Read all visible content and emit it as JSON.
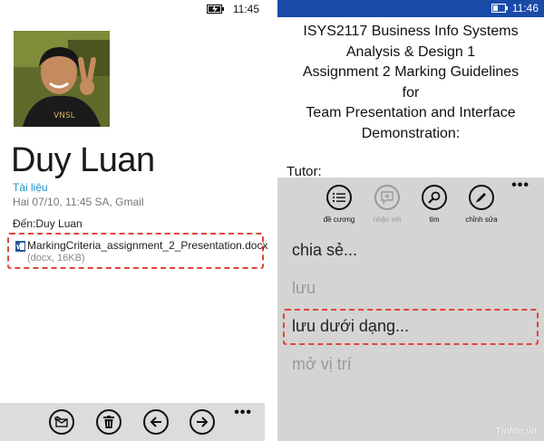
{
  "left": {
    "status": {
      "time": "11:45",
      "battery_icon": "battery-charging-icon"
    },
    "contact": {
      "name": "Duy Luan"
    },
    "email": {
      "folder": "Tài liệu",
      "meta": "Hai 07/10, 11:45 SA, Gmail",
      "to_label": "Đến:",
      "to_name": "Duy Luan",
      "attachment": {
        "filename": "MarkingCriteria_assignment_2_Presentation.docx",
        "info": "(docx, 16KB)",
        "icon": "word-doc-icon"
      }
    },
    "appbar": {
      "more": "•••"
    }
  },
  "right": {
    "status": {
      "time": "11:46",
      "battery_icon": "battery-icon",
      "color": "#1a4aa8"
    },
    "document": {
      "title_lines": [
        "ISYS2117 Business Info Systems",
        "Analysis & Design 1",
        "Assignment 2 Marking Guidelines",
        "for",
        "Team Presentation and Interface",
        "Demonstration:"
      ],
      "tutor": "Tutor:"
    },
    "menu": {
      "more": "•••",
      "tools": [
        {
          "label": "đề cương",
          "icon": "outline-icon",
          "enabled": true
        },
        {
          "label": "nhận xét",
          "icon": "comment-icon",
          "enabled": false
        },
        {
          "label": "tìm",
          "icon": "search-icon",
          "enabled": true
        },
        {
          "label": "chỉnh sửa",
          "icon": "edit-icon",
          "enabled": true
        }
      ],
      "items": [
        {
          "label": "chia sẻ...",
          "enabled": true
        },
        {
          "label": "lưu",
          "enabled": false
        },
        {
          "label": "lưu dưới dạng...",
          "enabled": true
        },
        {
          "label": "mở vị trí",
          "enabled": false
        }
      ]
    },
    "watermark": "Tinhte.vn"
  },
  "colors": {
    "accent_link": "#1e90c8",
    "highlight_dash": "#e0453a",
    "appbar_bg": "#dcdcdc",
    "menu_bg": "#d4d4d4"
  }
}
